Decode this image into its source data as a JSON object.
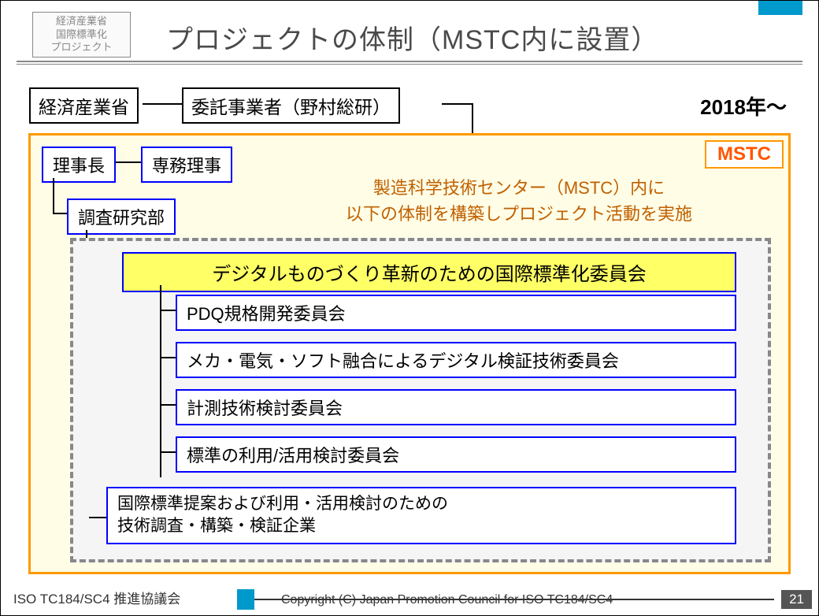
{
  "header": {
    "logo_lines": "経済産業省\n国際標準化\nプロジェクト",
    "title": "プロジェクトの体制（MSTC内に設置）"
  },
  "top_row": {
    "ministry": "経済産業省",
    "contractor": "委託事業者（野村総研）",
    "year": "2018年～"
  },
  "mstc": {
    "label": "MSTC",
    "president": "理事長",
    "exec_director": "専務理事",
    "research_dept": "調査研究部",
    "description": "製造科学技術センター（MSTC）内に\n以下の体制を構築しプロジェクト活動を実施",
    "main_committee": "デジタルものづくり革新のための国際標準化委員会",
    "sub_committees": [
      "PDQ規格開発委員会",
      "メカ・電気・ソフト融合によるデジタル検証技術委員会",
      "計測技術検討委員会",
      "標準の利用/活用検討委員会"
    ],
    "investigation": "国際標準提案および利用・活用検討のための\n技術調査・構築・検証企業"
  },
  "footer": {
    "left": "ISO TC184/SC4 推進協議会",
    "copyright": "Copyright (C) Japan Promotion Council for ISO TC184/SC4",
    "page": "21"
  }
}
